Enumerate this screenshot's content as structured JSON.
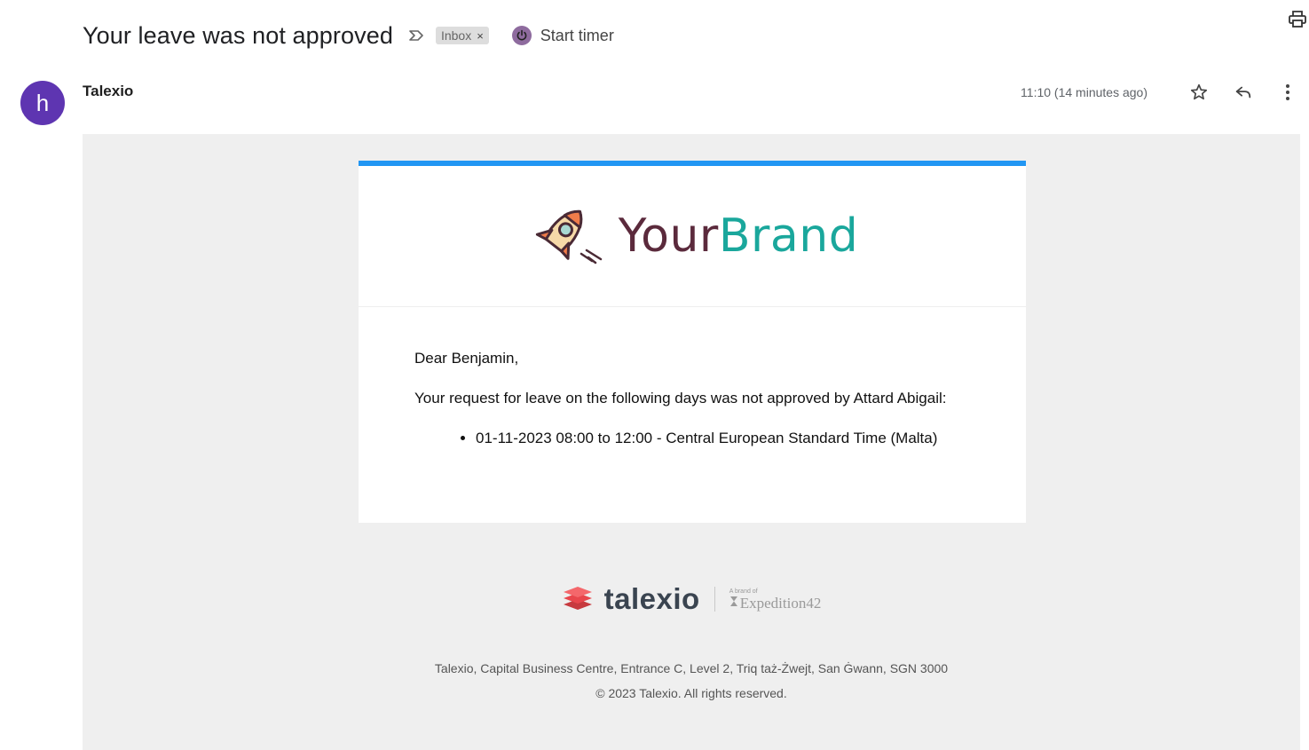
{
  "email": {
    "subject": "Your leave was not approved",
    "label": "Inbox",
    "label_close": "×",
    "timer_label": "Start timer",
    "avatar_letter": "h",
    "sender": "Talexio",
    "time": "11:10 (14 minutes ago)"
  },
  "body": {
    "brand_your": "Your",
    "brand_brand": "Brand",
    "greeting": "Dear Benjamin,",
    "message": "Your request for leave on the following days was not approved by Attard Abigail:",
    "items": [
      "01-11-2023 08:00 to 12:00 - Central European Standard Time (Malta)"
    ]
  },
  "footer": {
    "logo_word": "talexio",
    "brand_of": "A brand of",
    "parent_brand": "Expedition42",
    "address": "Talexio, Capital Business Centre, Entrance C, Level 2, Triq taż-Żwejt, San Ġwann, SGN 3000",
    "copyright": "© 2023 Talexio. All rights reserved."
  },
  "colors": {
    "accent_bar": "#2196f3",
    "avatar": "#5e35b1",
    "brand_dark": "#5b2a3c",
    "brand_teal": "#1aa79c",
    "talexio_red": "#f0484e"
  },
  "icons": [
    "label-arrow-icon",
    "power-icon",
    "print-icon",
    "star-icon",
    "reply-icon",
    "more-vert-icon",
    "rocket-icon",
    "talexio-stack-icon",
    "hourglass-icon"
  ]
}
